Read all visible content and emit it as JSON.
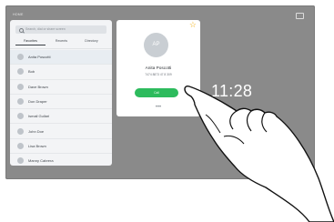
{
  "topbar": {
    "home_label": "HOME"
  },
  "contacts": {
    "search_placeholder": "Search, dial or share screen",
    "tabs": [
      {
        "label": "Favorites"
      },
      {
        "label": "Recents"
      },
      {
        "label": "Directory"
      }
    ],
    "items": [
      {
        "name": "Anita Poscotti"
      },
      {
        "name": "Bob"
      },
      {
        "name": "Dave Brown"
      },
      {
        "name": "Don Draper"
      },
      {
        "name": "Ismail Gullari"
      },
      {
        "name": "John Doe"
      },
      {
        "name": "Lisa Brown"
      },
      {
        "name": "Manny Cabrera"
      }
    ]
  },
  "details": {
    "initials": "AP",
    "name": "Anita Poscotti",
    "number": "7474 8873 47 8 309",
    "call_label": "Call",
    "more_label": "•••"
  },
  "clock": {
    "time": "11:28"
  },
  "colors": {
    "call_button": "#2DBB5D",
    "favorite_star": "#F2B21A",
    "screen_bg": "#8A8A8A"
  }
}
